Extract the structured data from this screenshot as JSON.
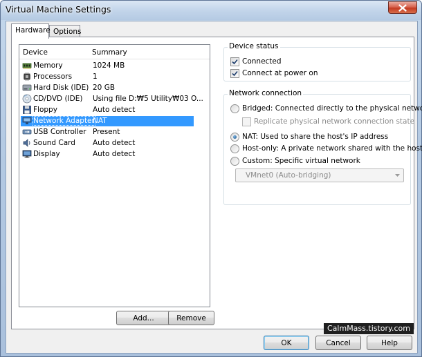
{
  "window": {
    "title": "Virtual Machine Settings"
  },
  "tabs": [
    {
      "label": "Hardware",
      "active": true
    },
    {
      "label": "Options",
      "active": false
    }
  ],
  "device_list": {
    "columns": [
      "Device",
      "Summary"
    ],
    "rows": [
      {
        "device": "Memory",
        "summary": "1024 MB",
        "icon": "memory-icon"
      },
      {
        "device": "Processors",
        "summary": "1",
        "icon": "processor-icon"
      },
      {
        "device": "Hard Disk (IDE)",
        "summary": "20 GB",
        "icon": "hard-disk-icon"
      },
      {
        "device": "CD/DVD (IDE)",
        "summary": "Using file D:₩5 Utility₩03 O...",
        "icon": "cd-dvd-icon"
      },
      {
        "device": "Floppy",
        "summary": "Auto detect",
        "icon": "floppy-icon"
      },
      {
        "device": "Network Adapter",
        "summary": "NAT",
        "icon": "network-adapter-icon",
        "selected": true
      },
      {
        "device": "USB Controller",
        "summary": "Present",
        "icon": "usb-icon"
      },
      {
        "device": "Sound Card",
        "summary": "Auto detect",
        "icon": "sound-card-icon"
      },
      {
        "device": "Display",
        "summary": "Auto detect",
        "icon": "display-icon"
      }
    ]
  },
  "list_buttons": {
    "add": "Add...",
    "remove": "Remove"
  },
  "device_status": {
    "title": "Device status",
    "connected": {
      "label": "Connected",
      "checked": true
    },
    "connect_at_power_on": {
      "label": "Connect at power on",
      "checked": true
    }
  },
  "network_connection": {
    "title": "Network connection",
    "bridged": {
      "label": "Bridged: Connected directly to the physical network",
      "selected": false
    },
    "replicate": {
      "label": "Replicate physical network connection state",
      "checked": false,
      "enabled": false
    },
    "nat": {
      "label": "NAT: Used to share the host's IP address",
      "selected": true
    },
    "host_only": {
      "label": "Host-only: A private network shared with the host",
      "selected": false
    },
    "custom": {
      "label": "Custom: Specific virtual network",
      "selected": false
    },
    "custom_select": {
      "value": "VMnet0 (Auto-bridging)",
      "enabled": false
    }
  },
  "dialog_buttons": {
    "ok": "OK",
    "cancel": "Cancel",
    "help": "Help"
  },
  "watermark": "CalmMass.tistory.com",
  "colors": {
    "selection": "#3399ff",
    "close_button": "#c33a22"
  }
}
